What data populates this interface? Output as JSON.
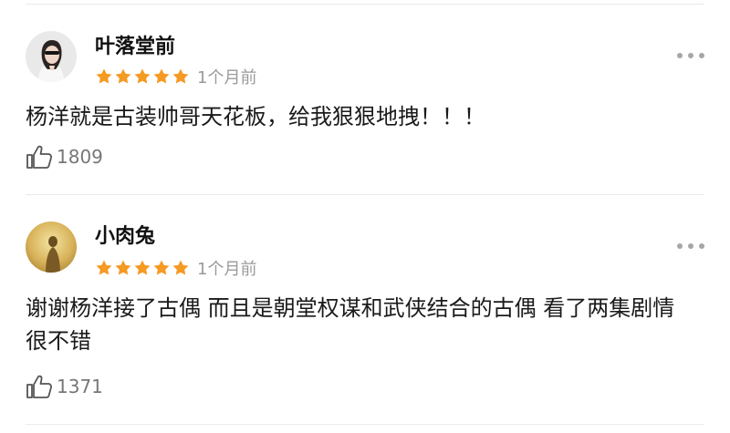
{
  "colors": {
    "star": "#f59a23",
    "text": "#1a1a1a",
    "muted": "#9a9a9a",
    "divider": "#ebebeb"
  },
  "comments": [
    {
      "username": "叶落堂前",
      "rating": 5,
      "time": "1个月前",
      "text": "杨洋就是古装帅哥天花板，给我狠狠地拽！！！",
      "likes": "1809",
      "avatar_icon": "woman-portrait-avatar"
    },
    {
      "username": "小肉兔",
      "rating": 5,
      "time": "1个月前",
      "text": "谢谢杨洋接了古偶 而且是朝堂权谋和武侠结合的古偶 看了两集剧情很不错",
      "likes": "1371",
      "avatar_icon": "golden-figure-avatar"
    }
  ]
}
